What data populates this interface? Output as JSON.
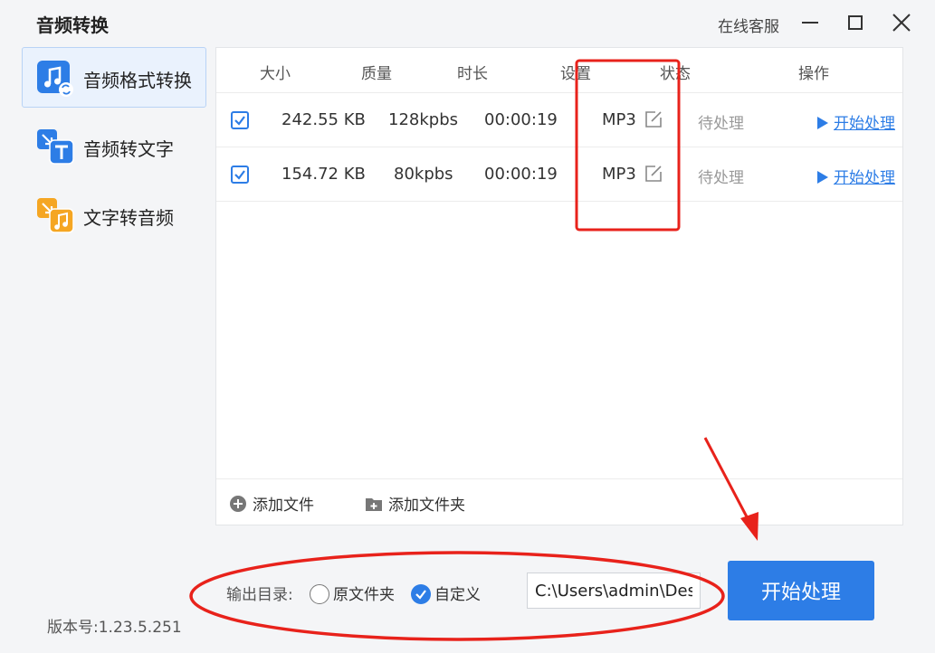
{
  "app": {
    "title": "音频转换",
    "online_service": "在线客服",
    "version": "版本号:1.23.5.251"
  },
  "sidebar": {
    "items": [
      {
        "label": "音频格式转换",
        "icon": "music-convert-icon",
        "active": true
      },
      {
        "label": "音频转文字",
        "icon": "audio-to-text-icon",
        "active": false
      },
      {
        "label": "文字转音频",
        "icon": "text-to-audio-icon",
        "active": false
      }
    ]
  },
  "table": {
    "headers": [
      "大小",
      "质量",
      "时长",
      "设置",
      "状态",
      "操作"
    ],
    "rows": [
      {
        "checked": true,
        "size": "242.55 KB",
        "quality": "128kpbs",
        "duration": "00:00:19",
        "format": "MP3",
        "status": "待处理",
        "action": "开始处理"
      },
      {
        "checked": true,
        "size": "154.72 KB",
        "quality": "80kpbs",
        "duration": "00:00:19",
        "format": "MP3",
        "status": "待处理",
        "action": "开始处理"
      }
    ]
  },
  "footer": {
    "add_file": "添加文件",
    "add_folder": "添加文件夹"
  },
  "output": {
    "label": "输出目录:",
    "option_original": "原文件夹",
    "option_custom": "自定义",
    "selected": "自定义",
    "path": "C:\\Users\\admin\\Des"
  },
  "start_button": "开始处理",
  "colors": {
    "accent": "#2d7de6",
    "annotation": "#e8221b"
  }
}
